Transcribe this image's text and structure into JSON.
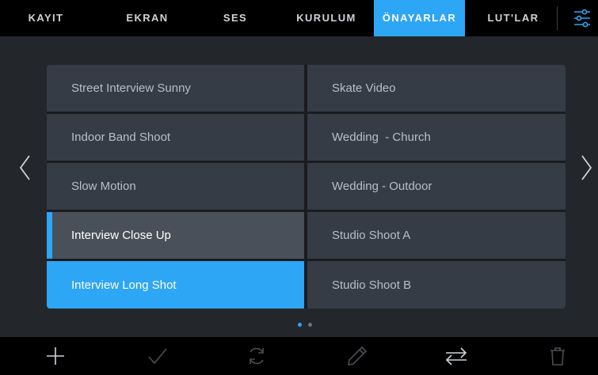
{
  "tabs": [
    {
      "label": "KAYIT",
      "active": false
    },
    {
      "label": "EKRAN",
      "active": false
    },
    {
      "label": "SES",
      "active": false
    },
    {
      "label": "KURULUM",
      "active": false
    },
    {
      "label": "ÖNAYARLAR",
      "active": true
    },
    {
      "label": "LUT'LAR",
      "active": false
    }
  ],
  "settings_icon": "sliders-icon",
  "presets": {
    "left_column": [
      {
        "label": "Street Interview Sunny",
        "state": "normal"
      },
      {
        "label": "Indoor Band Shoot",
        "state": "normal"
      },
      {
        "label": "Slow Motion",
        "state": "normal"
      },
      {
        "label": "Interview Close Up",
        "state": "highlighted"
      },
      {
        "label": "Interview Long Shot",
        "state": "selected"
      }
    ],
    "right_column": [
      {
        "label": "Skate Video",
        "state": "normal"
      },
      {
        "label": "Wedding  - Church",
        "state": "normal"
      },
      {
        "label": "Wedding - Outdoor",
        "state": "normal"
      },
      {
        "label": "Studio Shoot A",
        "state": "normal"
      },
      {
        "label": "Studio Shoot B",
        "state": "normal"
      }
    ]
  },
  "navigation": {
    "previous_icon": "chevron-left-icon",
    "next_icon": "chevron-right-icon"
  },
  "pagination": {
    "pages": 2,
    "current": 1
  },
  "toolbar_icons": [
    "plus-icon",
    "check-icon",
    "refresh-icon",
    "pencil-icon",
    "swap-arrows-icon",
    "trash-icon"
  ],
  "colors": {
    "accent": "#2da6f6",
    "background": "#23262b",
    "cell": "#353c45",
    "cell_highlight": "#4a5059",
    "text": "#b7bec6"
  }
}
